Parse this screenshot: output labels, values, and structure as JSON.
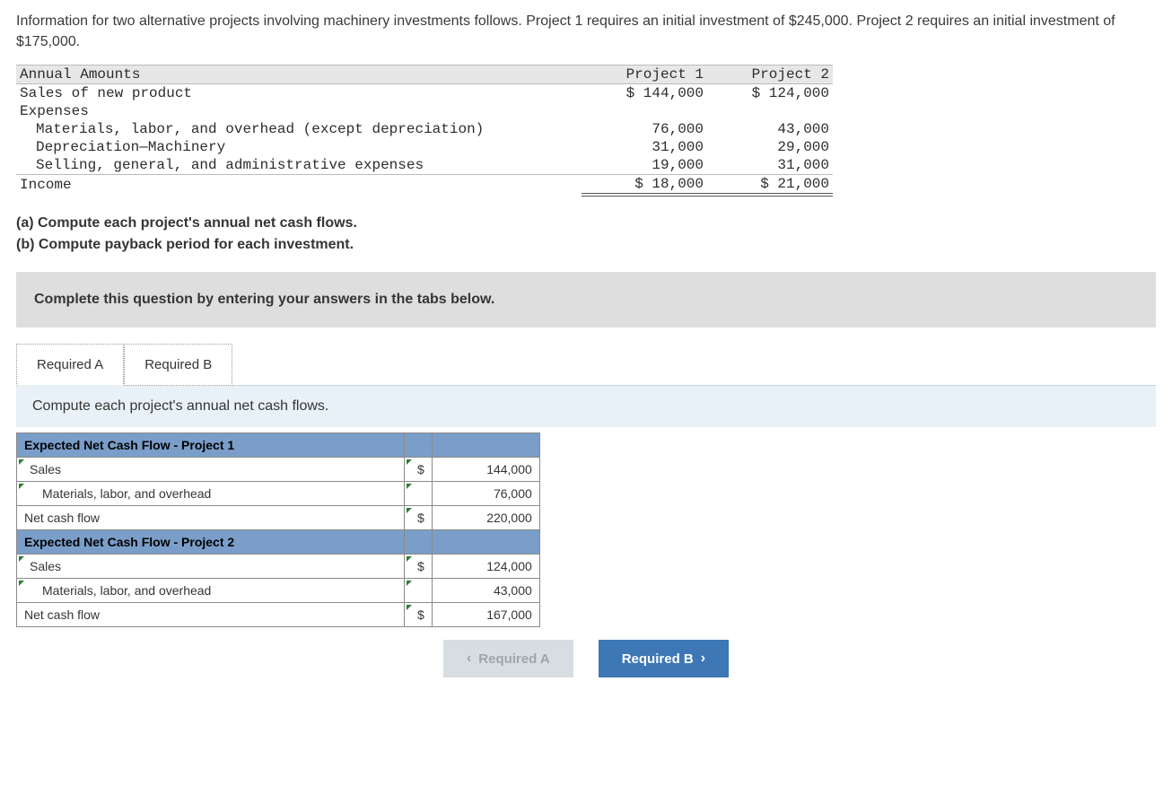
{
  "intro": "Information for two alternative projects involving machinery investments follows. Project 1 requires an initial investment of $245,000. Project 2 requires an initial investment of $175,000.",
  "dataTable": {
    "headers": {
      "label": "Annual Amounts",
      "p1": "Project 1",
      "p2": "Project 2"
    },
    "sales": {
      "label": "Sales of new product",
      "p1": "$ 144,000",
      "p2": "$ 124,000"
    },
    "expensesLabel": "Expenses",
    "exp": {
      "mat": {
        "label": "Materials, labor, and overhead (except depreciation)",
        "p1": "76,000",
        "p2": "43,000"
      },
      "dep": {
        "label": "Depreciation—Machinery",
        "p1": "31,000",
        "p2": "29,000"
      },
      "sga": {
        "label": "Selling, general, and administrative expenses",
        "p1": "19,000",
        "p2": "31,000"
      }
    },
    "income": {
      "label": "Income",
      "p1": "$ 18,000",
      "p2": "$ 21,000"
    }
  },
  "questions": {
    "a": "(a) Compute each project's annual net cash flows.",
    "b": "(b) Compute payback period for each investment."
  },
  "instr": "Complete this question by entering your answers in the tabs below.",
  "tabs": {
    "a": "Required A",
    "b": "Required B"
  },
  "tabDesc": "Compute each project's annual net cash flows.",
  "answer": {
    "p1hdr": "Expected Net Cash Flow - Project 1",
    "p2hdr": "Expected Net Cash Flow - Project 2",
    "rows": {
      "sales": "Sales",
      "mat": "Materials, labor, and overhead",
      "ncf": "Net cash flow"
    },
    "vals": {
      "p1_sales_sym": "$",
      "p1_sales": "144,000",
      "p1_mat_sym": "",
      "p1_mat": "76,000",
      "p1_ncf_sym": "$",
      "p1_ncf": "220,000",
      "p2_sales_sym": "$",
      "p2_sales": "124,000",
      "p2_mat_sym": "",
      "p2_mat": "43,000",
      "p2_ncf_sym": "$",
      "p2_ncf": "167,000"
    }
  },
  "nav": {
    "prev": "Required A",
    "next": "Required B"
  }
}
